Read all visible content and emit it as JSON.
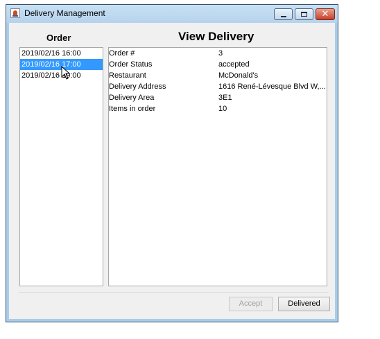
{
  "window": {
    "title": "Delivery Management"
  },
  "order_panel": {
    "heading": "Order",
    "items": [
      "2019/02/16 16:00",
      "2019/02/16 17:00",
      "2019/02/16 19:00"
    ],
    "selected_index": 1
  },
  "view_panel": {
    "heading": "View Delivery",
    "rows": [
      {
        "label": "Order #",
        "value": "3"
      },
      {
        "label": "Order Status",
        "value": "accepted"
      },
      {
        "label": "Restaurant",
        "value": "McDonald's"
      },
      {
        "label": "Delivery Address",
        "value": "1616 René-Lévesque Blvd W,..."
      },
      {
        "label": "Delivery Area",
        "value": "3E1"
      },
      {
        "label": "Items in order",
        "value": "10"
      }
    ]
  },
  "buttons": {
    "accept_label": "Accept",
    "accept_enabled": false,
    "delivered_label": "Delivered"
  },
  "colors": {
    "selection": "#3399ff",
    "window_frame": "#a9cdeb"
  }
}
